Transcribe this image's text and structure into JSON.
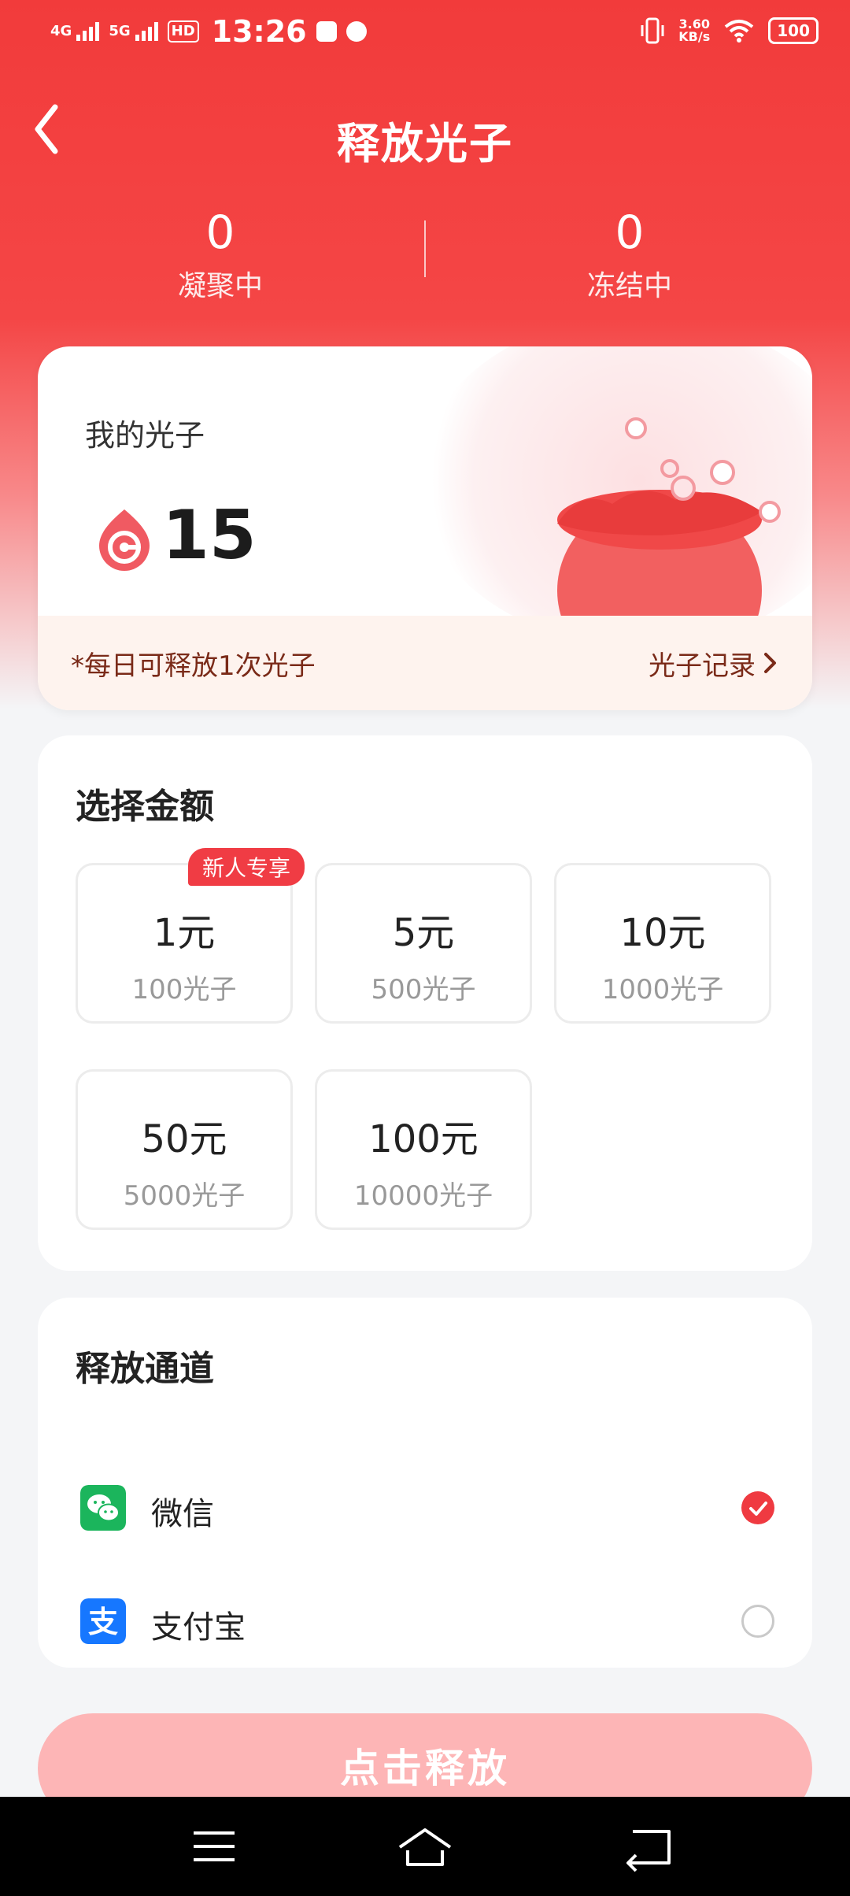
{
  "status_bar": {
    "network_1": "4G",
    "network_2": "5G",
    "hd": "HD",
    "time": "13:26",
    "speed_value": "3.60",
    "speed_unit": "KB/s",
    "battery": "100"
  },
  "header": {
    "title": "释放光子",
    "back_icon": "chevron-left-icon"
  },
  "stats": [
    {
      "value": "0",
      "label": "凝聚中"
    },
    {
      "value": "0",
      "label": "冻结中"
    }
  ],
  "photon_card": {
    "label": "我的光子",
    "count": "15",
    "note": "*每日可释放1次光子",
    "record_link": "光子记录"
  },
  "amount_section": {
    "title": "选择金额",
    "options": [
      {
        "amount": "1元",
        "photons": "100光子",
        "badge": "新人专享"
      },
      {
        "amount": "5元",
        "photons": "500光子"
      },
      {
        "amount": "10元",
        "photons": "1000光子"
      },
      {
        "amount": "50元",
        "photons": "5000光子"
      },
      {
        "amount": "100元",
        "photons": "10000光子"
      }
    ]
  },
  "channel_section": {
    "title": "释放通道",
    "channels": [
      {
        "name": "微信",
        "icon": "wechat-icon",
        "selected": true,
        "color": "#1bb55c"
      },
      {
        "name": "支付宝",
        "icon": "alipay-icon",
        "selected": false,
        "color": "#1677ff"
      }
    ]
  },
  "release_button": {
    "label": "点击释放"
  },
  "colors": {
    "primary_red": "#f23b3b",
    "button_disabled": "#fdb5b6",
    "footer_text": "#7a2a18"
  }
}
